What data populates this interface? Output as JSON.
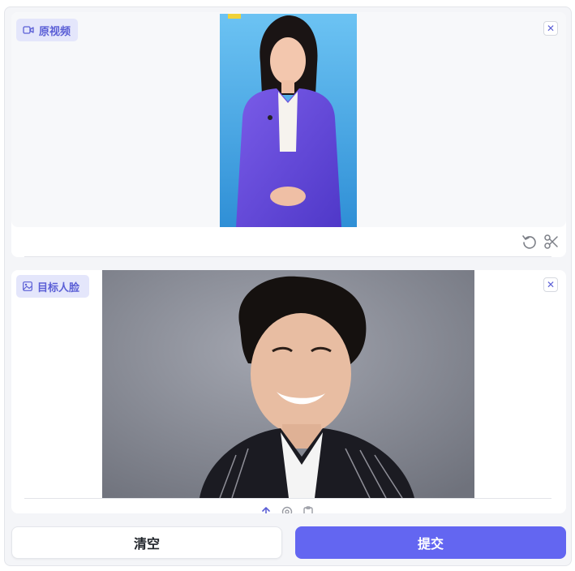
{
  "video_panel": {
    "label": "原视频",
    "icons": {
      "label": "video-icon",
      "close": "close-icon",
      "reset": "undo-icon",
      "trim": "scissors-icon"
    }
  },
  "face_panel": {
    "label": "目标人脸",
    "icons": {
      "label": "image-icon",
      "close": "close-icon",
      "upload": "upload-icon",
      "webcam": "camera-icon",
      "paste": "clipboard-icon"
    }
  },
  "actions": {
    "clear_label": "清空",
    "submit_label": "提交"
  },
  "colors": {
    "accent": "#6366f1",
    "accent_chip_bg": "#e4e6fb",
    "video_bg": "#4aa6e6",
    "photo_bg": "#8a8d98"
  }
}
